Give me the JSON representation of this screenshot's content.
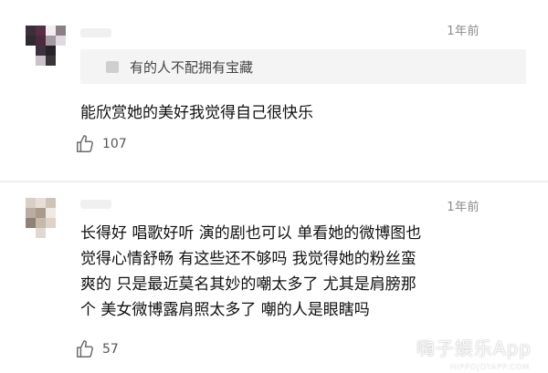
{
  "comments": [
    {
      "time": "1年前",
      "quoted_reply": "有的人不配拥有宝藏",
      "lines": [
        "能欣赏她的美好我觉得自己很快乐"
      ],
      "likes": "107",
      "avatar_colors": [
        "#3a2f3a",
        "#5b2d44",
        "#f2eef0",
        "#8a7f85",
        "#2f2a31",
        "#4c2a3e",
        "#a49aa1",
        "#e0dade",
        "#ffffff",
        "#3d3340",
        "#27222a",
        "#ffffff",
        "#ffffff",
        "#c9c2c7",
        "#3b3439",
        "#ffffff"
      ]
    },
    {
      "time": "1年前",
      "lines": [
        "长得好 唱歌好听 演的剧也可以 单看她的微博图也",
        "觉得心情舒畅 有这些还不够吗 我觉得她的粉丝蛮",
        "爽的 只是最近莫名其妙的嘲太多了 尤其是肩膀那",
        "个 美女微博露肩照太多了 嘲的人是眼瞎吗"
      ],
      "likes": "57",
      "avatar_colors": [
        "#d9cfc4",
        "#e7dfd6",
        "#cfc3b6",
        "#ffffff",
        "#b9ad9e",
        "#a89b8c",
        "#efe9e3",
        "#ffffff",
        "#8f8273",
        "#c6b9aa",
        "#ddd3c9",
        "#ffffff",
        "#ffffff",
        "#e1d8cf",
        "#ffffff",
        "#ffffff"
      ]
    }
  ],
  "watermark": {
    "text": "嗨子娱乐App",
    "sub": "HIPPOJOYAPP.COM"
  },
  "colors": {
    "quote_bg": "#f4f4f4",
    "time": "#8a8a8a",
    "divider": "#eeeeee"
  },
  "icons": {
    "like": "thumbs-up-icon"
  }
}
